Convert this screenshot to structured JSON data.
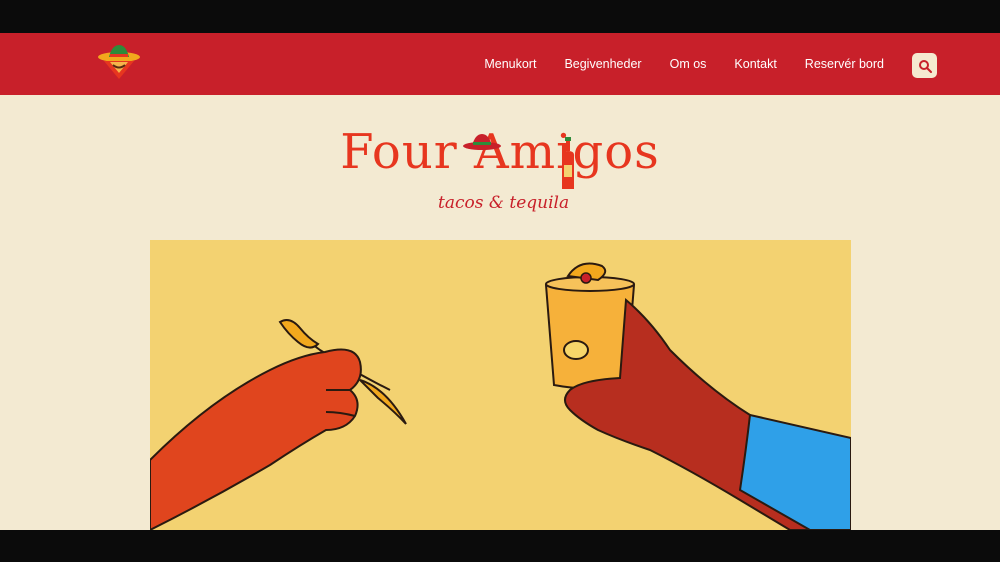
{
  "nav": {
    "items": [
      {
        "label": "Menukort"
      },
      {
        "label": "Begivenheder"
      },
      {
        "label": "Om os"
      },
      {
        "label": "Kontakt"
      },
      {
        "label": "Reservér bord"
      }
    ]
  },
  "brand": {
    "title": "Four Amigos",
    "tagline": "tacos & tequila"
  },
  "icons": {
    "logo": "sombrero-logo-icon",
    "search": "search-icon"
  },
  "colors": {
    "header": "#c8202a",
    "background": "#f3ead2",
    "title": "#e7361f",
    "hero": "#f3d271"
  }
}
